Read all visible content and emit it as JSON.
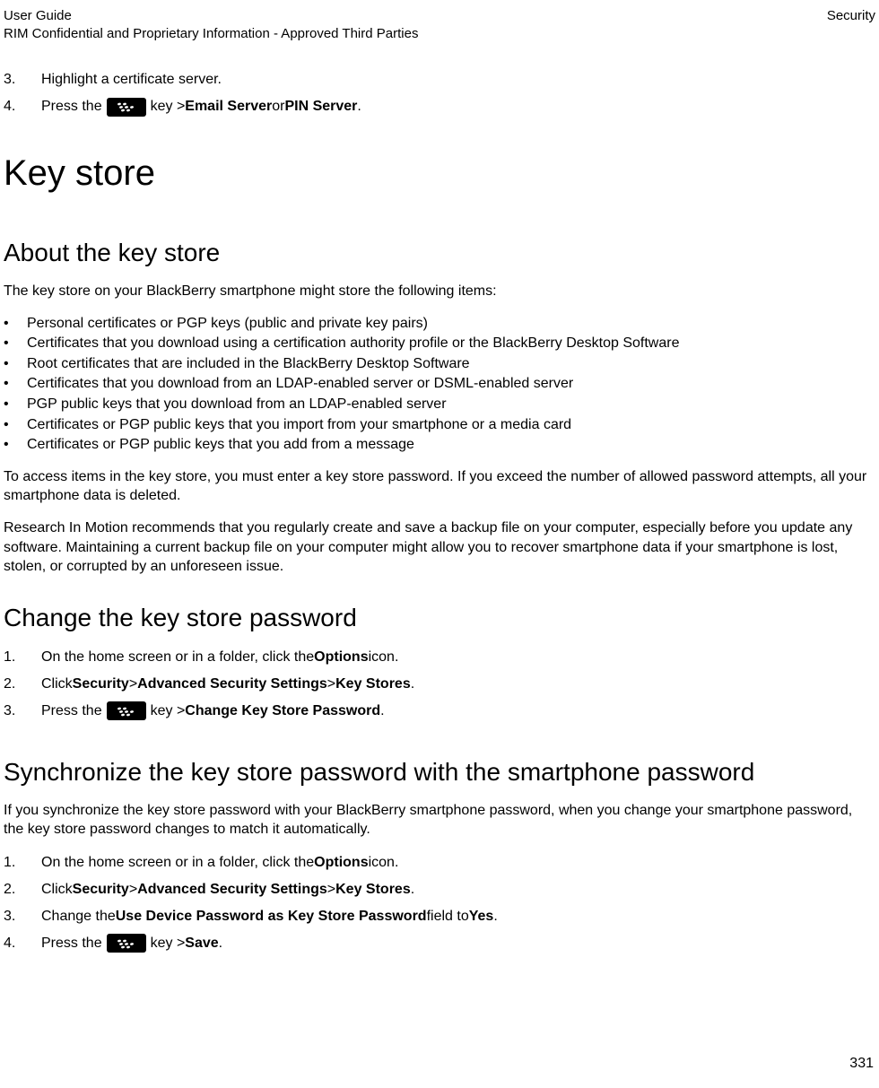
{
  "header": {
    "left_line1": "User Guide",
    "left_line2": "RIM Confidential and Proprietary Information - Approved Third Parties",
    "right": "Security"
  },
  "topSteps": [
    {
      "num": "3.",
      "text": "Highlight a certificate server."
    },
    {
      "num": "4.",
      "pre": "Press the ",
      "post_before_bold1": " key > ",
      "bold1": "Email Server",
      "between": " or ",
      "bold2": "PIN Server",
      "end": "."
    }
  ],
  "h1": "Key store",
  "about": {
    "heading": "About the key store",
    "intro": "The key store on your BlackBerry smartphone might store the following items:",
    "bullets": [
      "Personal certificates or PGP keys (public and private key pairs)",
      "Certificates that you download using a certification authority profile or the BlackBerry Desktop Software",
      "Root certificates that are included in the BlackBerry Desktop Software",
      "Certificates that you download from an LDAP-enabled server or DSML-enabled server",
      "PGP public keys that you download from an LDAP-enabled server",
      "Certificates or PGP public keys that you import from your smartphone or a media card",
      "Certificates or PGP public keys that you add from a message"
    ],
    "para2": "To access items in the key store, you must enter a key store password. If you exceed the number of allowed password attempts, all your smartphone data is deleted.",
    "para3": "Research In Motion recommends that you regularly create and save a backup file on your computer, especially before you update any software. Maintaining a current backup file on your computer might allow you to recover smartphone data if your smartphone is lost, stolen, or corrupted by an unforeseen issue."
  },
  "change": {
    "heading": "Change the key store password",
    "steps": [
      {
        "num": "1.",
        "parts": [
          "On the home screen or in a folder, click the ",
          {
            "b": "Options"
          },
          " icon."
        ]
      },
      {
        "num": "2.",
        "parts": [
          "Click ",
          {
            "b": "Security"
          },
          " > ",
          {
            "b": "Advanced Security Settings"
          },
          " > ",
          {
            "b": "Key Stores"
          },
          "."
        ]
      },
      {
        "num": "3.",
        "press": true,
        "parts": [
          " key > ",
          {
            "b": "Change Key Store Password"
          },
          "."
        ]
      }
    ]
  },
  "sync": {
    "heading": "Synchronize the key store password with the smartphone password",
    "intro": "If you synchronize the key store password with your BlackBerry smartphone password, when you change your smartphone password, the key store password changes to match it automatically.",
    "steps": [
      {
        "num": "1.",
        "parts": [
          "On the home screen or in a folder, click the ",
          {
            "b": "Options"
          },
          " icon."
        ]
      },
      {
        "num": "2.",
        "parts": [
          "Click ",
          {
            "b": "Security"
          },
          " > ",
          {
            "b": "Advanced Security Settings"
          },
          " > ",
          {
            "b": "Key Stores"
          },
          "."
        ]
      },
      {
        "num": "3.",
        "parts": [
          "Change the ",
          {
            "b": "Use Device Password as Key Store Password"
          },
          " field to ",
          {
            "b": "Yes"
          },
          "."
        ]
      },
      {
        "num": "4.",
        "press": true,
        "parts": [
          " key > ",
          {
            "b": "Save"
          },
          "."
        ]
      }
    ]
  },
  "pageNumber": "331",
  "labels": {
    "pressThe": "Press the "
  }
}
